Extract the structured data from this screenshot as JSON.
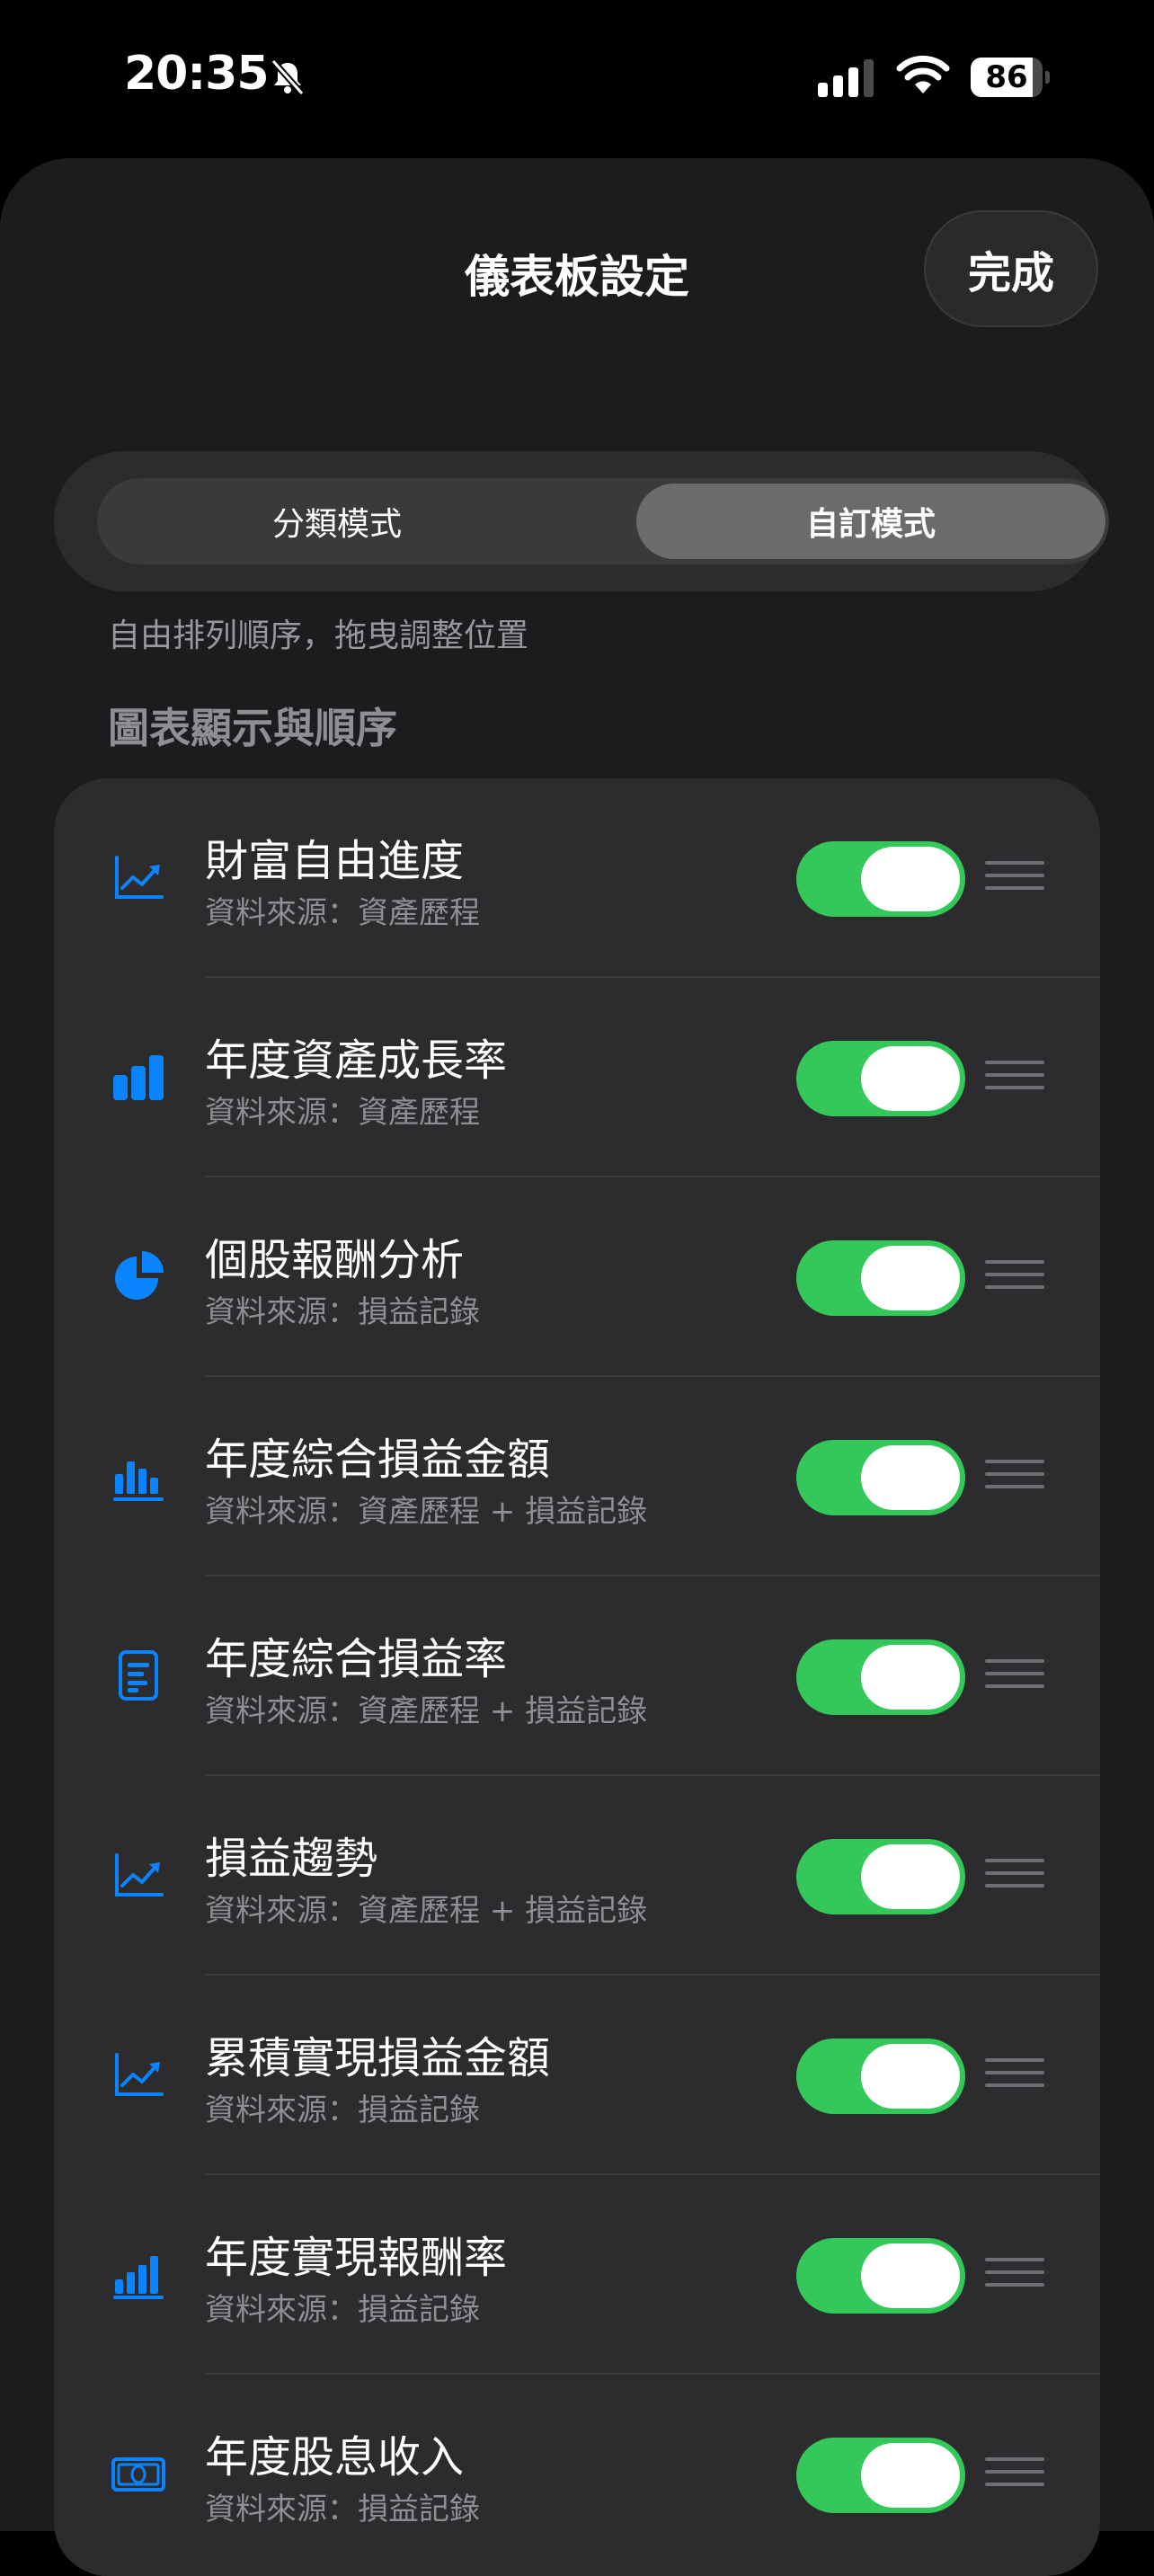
{
  "status_bar": {
    "time": "20:35",
    "battery": "86",
    "battery_level": 0.86
  },
  "header": {
    "title": "儀表板設定",
    "done_label": "完成"
  },
  "mode_switch": {
    "options": [
      "分類模式",
      "自訂模式"
    ],
    "selected_index": 1,
    "hint": "自由排列順序，拖曳調整位置"
  },
  "section": {
    "title": "圖表顯示與順序"
  },
  "accent_color": "#0a84ff",
  "toggle_on_color": "#34c759",
  "items": [
    {
      "title": "財富自由進度",
      "subtitle": "資料來源：資產歷程",
      "icon": "line-chart-icon",
      "enabled": true
    },
    {
      "title": "年度資產成長率",
      "subtitle": "資料來源：資產歷程",
      "icon": "bar-chart-icon",
      "enabled": true
    },
    {
      "title": "個股報酬分析",
      "subtitle": "資料來源：損益記錄",
      "icon": "pie-chart-icon",
      "enabled": true
    },
    {
      "title": "年度綜合損益金額",
      "subtitle": "資料來源：資產歷程 + 損益記錄",
      "icon": "column-chart-icon",
      "enabled": true
    },
    {
      "title": "年度綜合損益率",
      "subtitle": "資料來源：資產歷程 + 損益記錄",
      "icon": "report-icon",
      "enabled": true
    },
    {
      "title": "損益趨勢",
      "subtitle": "資料來源：資產歷程 + 損益記錄",
      "icon": "line-chart-icon",
      "enabled": true
    },
    {
      "title": "累積實現損益金額",
      "subtitle": "資料來源：損益記錄",
      "icon": "line-chart-icon",
      "enabled": true
    },
    {
      "title": "年度實現報酬率",
      "subtitle": "資料來源：損益記錄",
      "icon": "ascending-bars-icon",
      "enabled": true
    },
    {
      "title": "年度股息收入",
      "subtitle": "資料來源：損益記錄",
      "icon": "banknote-icon",
      "enabled": true
    }
  ]
}
